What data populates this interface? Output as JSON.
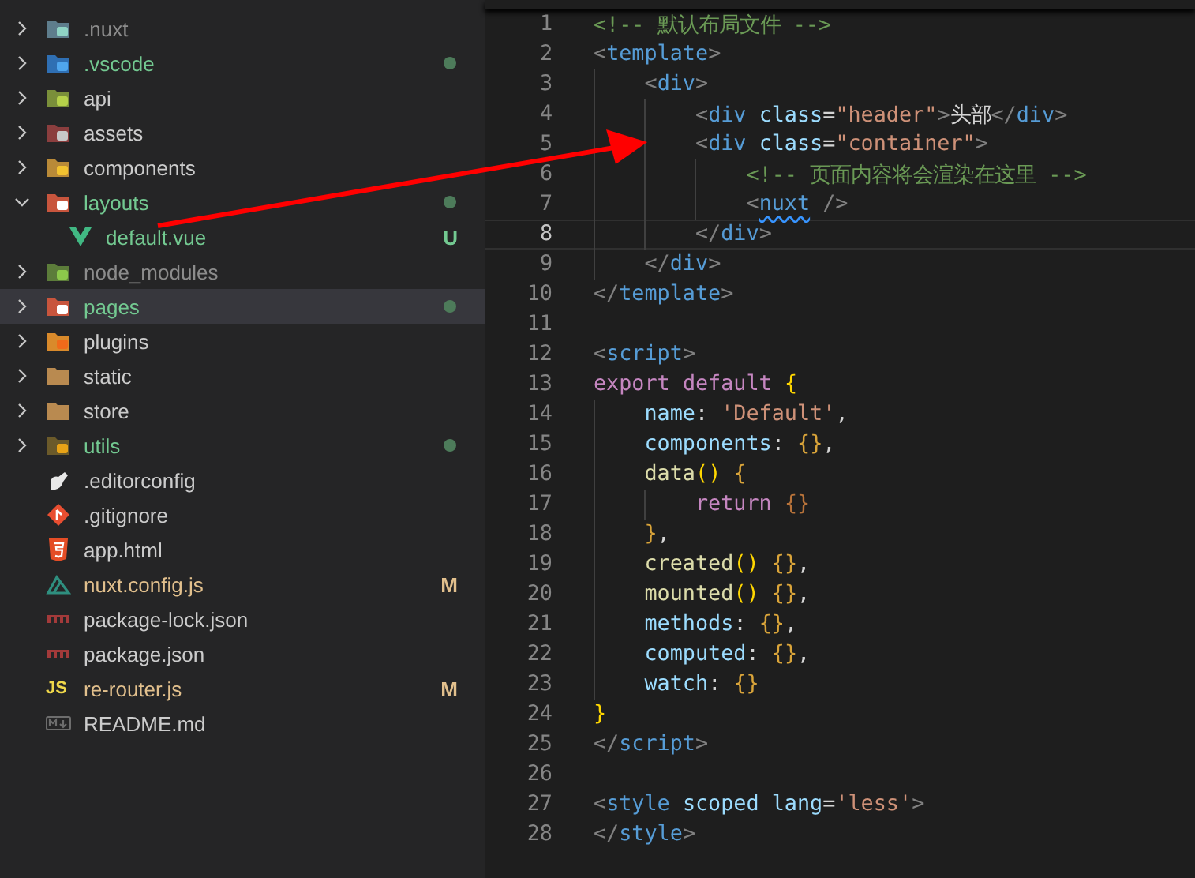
{
  "explorer": {
    "items": [
      {
        "label": ".nuxt",
        "kind": "nuxt-folder",
        "expanded": false,
        "selected": false,
        "ignored": true,
        "untracked": false,
        "modified": false,
        "dot": false
      },
      {
        "label": ".vscode",
        "kind": "vscode-folder",
        "expanded": false,
        "selected": false,
        "ignored": false,
        "untracked": true,
        "modified": false,
        "dot": true
      },
      {
        "label": "api",
        "kind": "api-folder",
        "expanded": false,
        "selected": false,
        "ignored": false,
        "untracked": false,
        "modified": false,
        "dot": false
      },
      {
        "label": "assets",
        "kind": "assets-folder",
        "expanded": false,
        "selected": false,
        "ignored": false,
        "untracked": false,
        "modified": false,
        "dot": false
      },
      {
        "label": "components",
        "kind": "components-folder",
        "expanded": false,
        "selected": false,
        "ignored": false,
        "untracked": false,
        "modified": false,
        "dot": false
      },
      {
        "label": "layouts",
        "kind": "layouts-folder",
        "expanded": true,
        "selected": false,
        "ignored": false,
        "untracked": true,
        "modified": false,
        "dot": true,
        "children": [
          {
            "label": "default.vue",
            "kind": "vue",
            "selected": false,
            "ignored": false,
            "untracked": true,
            "modified": false,
            "badge": "U"
          }
        ]
      },
      {
        "label": "node_modules",
        "kind": "node-folder",
        "expanded": false,
        "selected": false,
        "ignored": true,
        "untracked": false,
        "modified": false,
        "dot": false
      },
      {
        "label": "pages",
        "kind": "pages-folder",
        "expanded": false,
        "selected": true,
        "ignored": false,
        "untracked": true,
        "modified": false,
        "dot": true
      },
      {
        "label": "plugins",
        "kind": "plugins-folder",
        "expanded": false,
        "selected": false,
        "ignored": false,
        "untracked": false,
        "modified": false,
        "dot": false
      },
      {
        "label": "static",
        "kind": "folder",
        "expanded": false,
        "selected": false,
        "ignored": false,
        "untracked": false,
        "modified": false,
        "dot": false
      },
      {
        "label": "store",
        "kind": "folder",
        "expanded": false,
        "selected": false,
        "ignored": false,
        "untracked": false,
        "modified": false,
        "dot": false
      },
      {
        "label": "utils",
        "kind": "utils-folder",
        "expanded": false,
        "selected": false,
        "ignored": false,
        "untracked": true,
        "modified": false,
        "dot": true
      },
      {
        "label": ".editorconfig",
        "kind": "editorconfig",
        "selected": false,
        "ignored": false,
        "untracked": false,
        "modified": false
      },
      {
        "label": ".gitignore",
        "kind": "git",
        "selected": false,
        "ignored": false,
        "untracked": false,
        "modified": false
      },
      {
        "label": "app.html",
        "kind": "html",
        "selected": false,
        "ignored": false,
        "untracked": false,
        "modified": false
      },
      {
        "label": "nuxt.config.js",
        "kind": "nuxt",
        "selected": false,
        "ignored": false,
        "untracked": false,
        "modified": true,
        "badge": "M"
      },
      {
        "label": "package-lock.json",
        "kind": "npm",
        "selected": false,
        "ignored": false,
        "untracked": false,
        "modified": false
      },
      {
        "label": "package.json",
        "kind": "npm",
        "selected": false,
        "ignored": false,
        "untracked": false,
        "modified": false
      },
      {
        "label": "re-router.js",
        "kind": "js",
        "icon_text": "JS",
        "selected": false,
        "ignored": false,
        "untracked": false,
        "modified": true,
        "badge": "M"
      },
      {
        "label": "README.md",
        "kind": "markdown",
        "selected": false,
        "ignored": false,
        "untracked": false,
        "modified": false
      }
    ]
  },
  "editor": {
    "lines": [
      {
        "number": "1",
        "current": false,
        "warning": false,
        "text": "<!-- 默认布局文件 -->"
      },
      {
        "number": "2",
        "current": false,
        "warning": false,
        "text": "<template>"
      },
      {
        "number": "3",
        "current": false,
        "warning": false,
        "text": "    <div>"
      },
      {
        "number": "4",
        "current": false,
        "warning": false,
        "text": "        <div class=\"header\">头部</div>"
      },
      {
        "number": "5",
        "current": false,
        "warning": false,
        "text": "        <div class=\"container\">"
      },
      {
        "number": "6",
        "current": false,
        "warning": false,
        "text": "            <!-- 页面内容将会渲染在这里 -->"
      },
      {
        "number": "7",
        "current": false,
        "warning": true,
        "text": "            <nuxt />"
      },
      {
        "number": "8",
        "current": true,
        "warning": false,
        "text": "        </div>"
      },
      {
        "number": "9",
        "current": false,
        "warning": false,
        "text": "    </div>"
      },
      {
        "number": "10",
        "current": false,
        "warning": false,
        "text": "</template>"
      },
      {
        "number": "11",
        "current": false,
        "warning": false
      },
      {
        "number": "12",
        "current": false,
        "warning": false,
        "text": "<script>"
      },
      {
        "number": "13",
        "current": false,
        "warning": false,
        "text": "export default {"
      },
      {
        "number": "14",
        "current": false,
        "warning": false,
        "text": "    name: 'Default',"
      },
      {
        "number": "15",
        "current": false,
        "warning": false,
        "text": "    components: {},"
      },
      {
        "number": "16",
        "current": false,
        "warning": false,
        "text": "    data() {"
      },
      {
        "number": "17",
        "current": false,
        "warning": false,
        "text": "        return {}"
      },
      {
        "number": "18",
        "current": false,
        "warning": false,
        "text": "    },"
      },
      {
        "number": "19",
        "current": false,
        "warning": false,
        "text": "    created() {},"
      },
      {
        "number": "20",
        "current": false,
        "warning": false,
        "text": "    mounted() {},"
      },
      {
        "number": "21",
        "current": false,
        "warning": false,
        "text": "    methods: {},"
      },
      {
        "number": "22",
        "current": false,
        "warning": false,
        "text": "    computed: {},"
      },
      {
        "number": "23",
        "current": false,
        "warning": false,
        "text": "    watch: {}"
      },
      {
        "number": "24",
        "current": false,
        "warning": false,
        "text": "}"
      },
      {
        "number": "25",
        "current": false,
        "warning": false,
        "text": "</script>"
      },
      {
        "number": "26",
        "current": false,
        "warning": false
      },
      {
        "number": "27",
        "current": false,
        "warning": false,
        "text": "<style scoped lang='less'>"
      },
      {
        "number": "28",
        "current": false,
        "warning": false,
        "text": "</style>"
      }
    ]
  }
}
